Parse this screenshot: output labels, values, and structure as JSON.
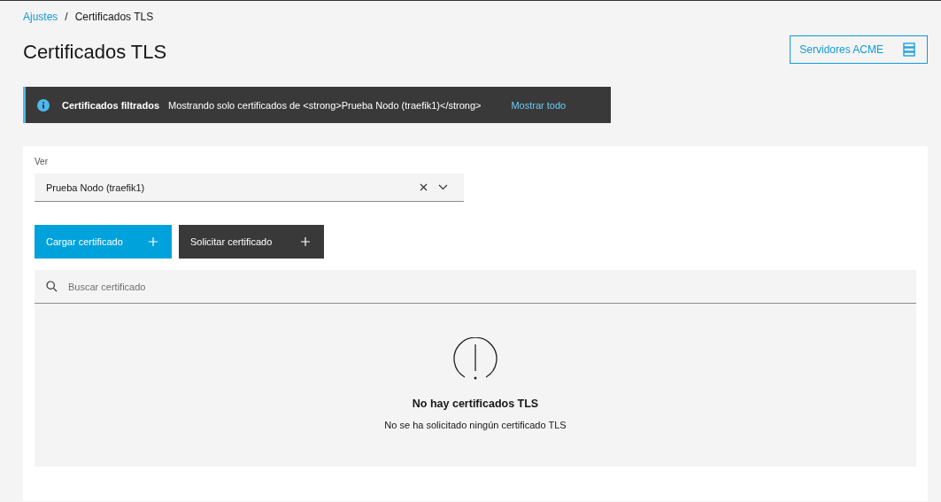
{
  "breadcrumb": [
    {
      "label": "Ajustes",
      "kind": "link"
    },
    {
      "label": "Certificados TLS",
      "kind": "current"
    }
  ],
  "breadcrumb_separator": "/",
  "page_title": "Certificados TLS",
  "header_button": {
    "label": "Servidores ACME"
  },
  "notification": {
    "title": "Certificados filtrados",
    "message": "Mostrando solo certificados de <strong>Prueba Nodo (traefik1)</strong>",
    "action": "Mostrar todo"
  },
  "view_select": {
    "label": "Ver",
    "value": "Prueba Nodo (traefik1)"
  },
  "buttons": [
    {
      "label": "Cargar certificado",
      "kind": "primary"
    },
    {
      "label": "Solicitar certificado",
      "kind": "secondary"
    }
  ],
  "search": {
    "placeholder": "Buscar certificado"
  },
  "empty_state": {
    "title": "No hay certificados TLS",
    "message": "No se ha solicitado ningún certificado TLS"
  }
}
